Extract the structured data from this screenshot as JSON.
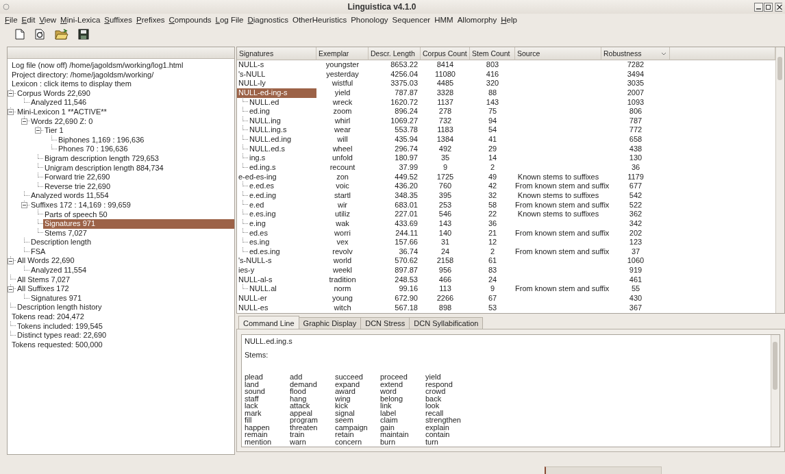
{
  "window": {
    "title": "Linguistica v4.1.0"
  },
  "menu": [
    {
      "label": "File",
      "underlined": true
    },
    {
      "label": "Edit",
      "underlined": true
    },
    {
      "label": "View",
      "underlined": true
    },
    {
      "label": "Mini-Lexica",
      "underlined": true
    },
    {
      "label": "Suffixes",
      "underlined": true
    },
    {
      "label": "Prefixes",
      "underlined": true
    },
    {
      "label": "Compounds",
      "underlined": true
    },
    {
      "label": "Log File",
      "underlined": true
    },
    {
      "label": "Diagnostics",
      "underlined": true
    },
    {
      "label": "OtherHeuristics",
      "underlined": false
    },
    {
      "label": "Phonology",
      "underlined": false
    },
    {
      "label": "Sequencer",
      "underlined": false
    },
    {
      "label": "HMM",
      "underlined": false
    },
    {
      "label": "Allomorphy",
      "underlined": false
    },
    {
      "label": "Help",
      "underlined": true
    }
  ],
  "toolbar": [
    {
      "kind": "new"
    },
    {
      "kind": "reload"
    },
    {
      "kind": "open"
    },
    {
      "kind": "save"
    }
  ],
  "tree": [
    {
      "label": "Log file (now off) /home/jagoldsm/working/log1.html",
      "selected": false
    },
    {
      "label": "Project directory: /home/jagoldsm/working/",
      "selected": false
    },
    {
      "label": "Lexicon : click items to display them",
      "selected": false,
      "children": [
        {
          "label": "Corpus Words 22,690",
          "selected": false,
          "expanded": true,
          "children": [
            {
              "label": "Analyzed 11,546",
              "selected": false
            }
          ]
        },
        {
          "label": "Mini-Lexicon 1 **ACTIVE**",
          "selected": false,
          "expanded": true,
          "children": [
            {
              "label": "Words 22,690 Z: 0",
              "selected": false,
              "expanded": true,
              "children": [
                {
                  "label": "Tier 1",
                  "selected": false,
                  "expanded": true,
                  "children": [
                    {
                      "label": "Biphones 1,169 : 196,636",
                      "selected": false
                    },
                    {
                      "label": "Phones 70 : 196,636",
                      "selected": false
                    }
                  ]
                },
                {
                  "label": "Bigram description length 729,653",
                  "selected": false
                },
                {
                  "label": "Unigram description length 884,734",
                  "selected": false
                },
                {
                  "label": "Forward trie 22,690",
                  "selected": false
                },
                {
                  "label": "Reverse trie 22,690",
                  "selected": false
                }
              ]
            },
            {
              "label": "Analyzed words 11,554",
              "selected": false
            },
            {
              "label": "Suffixes 172 : 14,169 : 99,659",
              "selected": false,
              "expanded": true,
              "children": [
                {
                  "label": "Parts of speech 50",
                  "selected": false
                },
                {
                  "label": "Signatures 971",
                  "selected": true
                },
                {
                  "label": "Stems 7,027",
                  "selected": false
                }
              ]
            },
            {
              "label": "Description length",
              "selected": false
            },
            {
              "label": "FSA",
              "selected": false
            }
          ]
        },
        {
          "label": "All Words 22,690",
          "selected": false,
          "expanded": true,
          "children": [
            {
              "label": "Analyzed 11,554",
              "selected": false
            }
          ]
        },
        {
          "label": "All Stems 7,027",
          "selected": false
        },
        {
          "label": "All Suffixes 172",
          "selected": false,
          "expanded": true,
          "children": [
            {
              "label": "Signatures 971",
              "selected": false
            }
          ]
        },
        {
          "label": "Description length history",
          "selected": false
        }
      ]
    },
    {
      "label": "Tokens read: 204,472",
      "selected": false,
      "children": [
        {
          "label": "Tokens included: 199,545",
          "selected": false
        },
        {
          "label": "Distinct types read: 22,690",
          "selected": false
        }
      ]
    },
    {
      "label": "Tokens requested: 500,000",
      "selected": false
    }
  ],
  "table": {
    "columns": [
      "Signatures",
      "Exemplar",
      "Descr. Length",
      "Corpus Count",
      "Stem Count",
      "Source",
      "Robustness"
    ],
    "rows": [
      {
        "cells": [
          "NULL-s",
          "youngster",
          "8653.22",
          "8414",
          "803",
          "",
          "7282"
        ],
        "selected": false
      },
      {
        "cells": [
          "'s-NULL",
          "yesterday",
          "4256.04",
          "11080",
          "416",
          "",
          "3494"
        ],
        "selected": false
      },
      {
        "cells": [
          "NULL-ly",
          "wistful",
          "3375.03",
          "4485",
          "320",
          "",
          "3035"
        ],
        "selected": false
      },
      {
        "cells": [
          "NULL-ed-ing-s",
          "yield",
          "787.87",
          "3328",
          "88",
          "",
          "2007"
        ],
        "selected": true,
        "children": [
          {
            "cells": [
              "NULL.ed",
              "wreck",
              "1620.72",
              "1137",
              "143",
              "",
              "1093"
            ],
            "selected": false
          },
          {
            "cells": [
              "ed.ing",
              "zoom",
              "896.24",
              "278",
              "75",
              "",
              "806"
            ],
            "selected": false
          },
          {
            "cells": [
              "NULL.ing",
              "whirl",
              "1069.27",
              "732",
              "94",
              "",
              "787"
            ],
            "selected": false
          },
          {
            "cells": [
              "NULL.ing.s",
              "wear",
              "553.78",
              "1183",
              "54",
              "",
              "772"
            ],
            "selected": false
          },
          {
            "cells": [
              "NULL.ed.ing",
              "will",
              "435.94",
              "1384",
              "41",
              "",
              "658"
            ],
            "selected": false
          },
          {
            "cells": [
              "NULL.ed.s",
              "wheel",
              "296.74",
              "492",
              "29",
              "",
              "438"
            ],
            "selected": false
          },
          {
            "cells": [
              "ing.s",
              "unfold",
              "180.97",
              "35",
              "14",
              "",
              "130"
            ],
            "selected": false
          },
          {
            "cells": [
              "ed.ing.s",
              "recount",
              "37.99",
              "9",
              "2",
              "",
              "36"
            ],
            "selected": false
          }
        ]
      },
      {
        "cells": [
          "e-ed-es-ing",
          "zon",
          "449.52",
          "1725",
          "49",
          "Known stems to suffixes",
          "1179"
        ],
        "selected": false,
        "children": [
          {
            "cells": [
              "e.ed.es",
              "voic",
              "436.20",
              "760",
              "42",
              "From known stem and suffix",
              "677"
            ],
            "selected": false
          },
          {
            "cells": [
              "e.ed.ing",
              "startl",
              "348.35",
              "395",
              "32",
              "Known stems to suffixes",
              "542"
            ],
            "selected": false
          },
          {
            "cells": [
              "e.ed",
              "wir",
              "683.01",
              "253",
              "58",
              "From known stem and suffix",
              "522"
            ],
            "selected": false
          },
          {
            "cells": [
              "e.es.ing",
              "utiliz",
              "227.01",
              "546",
              "22",
              "Known stems to suffixes",
              "362"
            ],
            "selected": false
          },
          {
            "cells": [
              "e.ing",
              "wak",
              "433.69",
              "143",
              "36",
              "",
              "342"
            ],
            "selected": false
          },
          {
            "cells": [
              "ed.es",
              "worri",
              "244.11",
              "140",
              "21",
              "From known stem and suffix",
              "202"
            ],
            "selected": false
          },
          {
            "cells": [
              "es.ing",
              "vex",
              "157.66",
              "31",
              "12",
              "",
              "123"
            ],
            "selected": false
          },
          {
            "cells": [
              "ed.es.ing",
              "revolv",
              "36.74",
              "24",
              "2",
              "From known stem and suffix",
              "37"
            ],
            "selected": false
          }
        ]
      },
      {
        "cells": [
          "'s-NULL-s",
          "world",
          "570.62",
          "2158",
          "61",
          "",
          "1060"
        ],
        "selected": false
      },
      {
        "cells": [
          "ies-y",
          "weekl",
          "897.87",
          "956",
          "83",
          "",
          "919"
        ],
        "selected": false
      },
      {
        "cells": [
          "NULL-al-s",
          "tradition",
          "248.53",
          "466",
          "24",
          "",
          "461"
        ],
        "selected": false,
        "children": [
          {
            "cells": [
              "NULL.al",
              "norm",
              "99.16",
              "113",
              "9",
              "From known stem and suffix",
              "55"
            ],
            "selected": false
          }
        ]
      },
      {
        "cells": [
          "NULL-er",
          "young",
          "672.90",
          "2266",
          "67",
          "",
          "430"
        ],
        "selected": false
      },
      {
        "cells": [
          "NULL-es",
          "witch",
          "567.18",
          "898",
          "53",
          "",
          "367"
        ],
        "selected": false
      }
    ]
  },
  "tabs": [
    {
      "label": "Command Line",
      "selected": true
    },
    {
      "label": "Graphic Display",
      "selected": false
    },
    {
      "label": "DCN Stress",
      "selected": false
    },
    {
      "label": "DCN Syllabification",
      "selected": false
    }
  ],
  "output": {
    "heading": "NULL.ed.ing.s",
    "subheading": "Stems:",
    "stems": [
      [
        "plead",
        "add",
        "succeed",
        "proceed",
        "yield"
      ],
      [
        "land",
        "demand",
        "expand",
        "extend",
        "respond"
      ],
      [
        "sound",
        "flood",
        "award",
        "word",
        "crowd"
      ],
      [
        "staff",
        "hang",
        "wing",
        "belong",
        "back"
      ],
      [
        "lack",
        "attack",
        "kick",
        "link",
        "look"
      ],
      [
        "mark",
        "appeal",
        "signal",
        "label",
        "recall"
      ],
      [
        "fill",
        "program",
        "seem",
        "claim",
        "strengthen"
      ],
      [
        "happen",
        "threaten",
        "campaign",
        "gain",
        "explain"
      ],
      [
        "remain",
        "train",
        "retain",
        "maintain",
        "contain"
      ],
      [
        "mention",
        "warn",
        "concern",
        "burn",
        "turn"
      ]
    ]
  }
}
